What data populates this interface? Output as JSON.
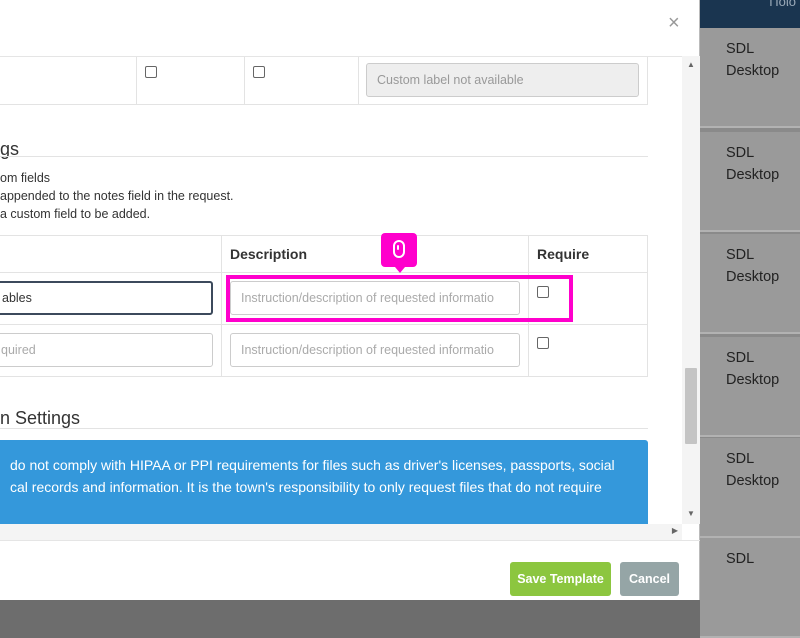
{
  "background": {
    "topbar_text": "Ποίο",
    "rows": [
      {
        "line1": "SDL",
        "line2": "Desktop"
      },
      {
        "line1": "SDL",
        "line2": "Desktop"
      },
      {
        "line1": "SDL",
        "line2": "Desktop"
      },
      {
        "line1": "SDL",
        "line2": "Desktop"
      },
      {
        "line1": "SDL",
        "line2": "Desktop"
      },
      {
        "line1": "SDL",
        "line2": ""
      }
    ]
  },
  "modal": {
    "close_icon": "×",
    "top_table": {
      "custom_label_placeholder": "Custom label not available"
    },
    "custom_fields_section": {
      "title": "gs",
      "help_lines": [
        "om fields",
        "appended to the notes field in the request.",
        "a custom field to be added."
      ],
      "headers": {
        "description": "Description",
        "require": "Require"
      },
      "rows": [
        {
          "name_value": "ables",
          "description_placeholder": "Instruction/description of requested informatio"
        },
        {
          "name_placeholder": "quired",
          "description_placeholder": "Instruction/description of requested informatio"
        }
      ]
    },
    "file_settings_section": {
      "title": "n Settings",
      "alert_lines": [
        "do not comply with HIPAA or PPI requirements for files such as driver's licenses, passports, social",
        "cal records and information. It is the town's responsibility to only request files that do not require"
      ]
    },
    "footer": {
      "save_label": "Save Template",
      "cancel_label": "Cancel"
    }
  },
  "colors": {
    "save_button": "#8cc63f",
    "cancel_button": "#95a5a6",
    "alert": "#3498db",
    "highlight": "#ff00cc"
  }
}
